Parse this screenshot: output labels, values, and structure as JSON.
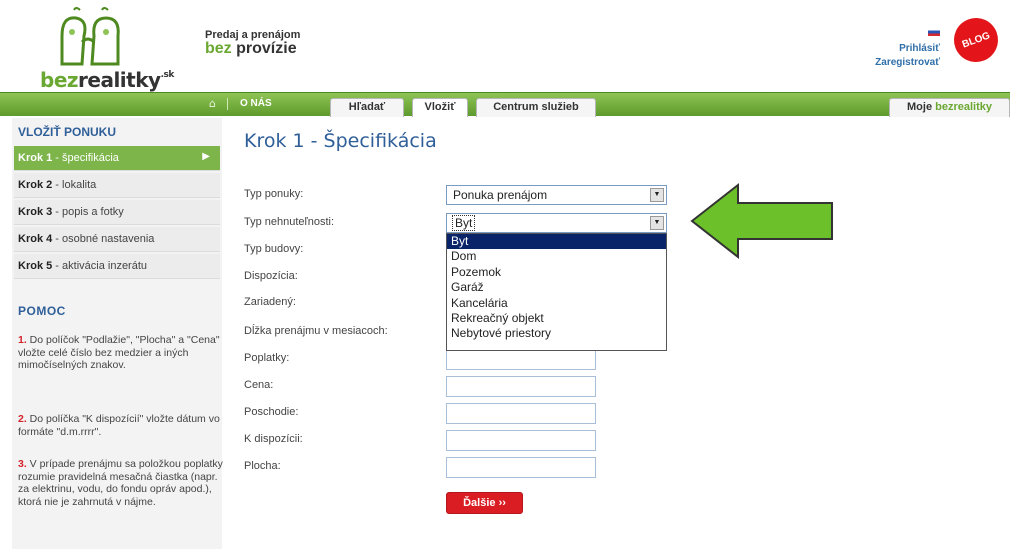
{
  "header": {
    "logo": {
      "brand_green": "bez",
      "brand_dark": "realitky",
      "brand_tld": ".sk"
    },
    "tagline": {
      "line1": "Predaj a prenájom",
      "line2_green": "bez",
      "line2_dark": "provízie"
    },
    "user_links": {
      "login": "Prihlásiť",
      "register": "Zaregistrovať"
    },
    "blog_badge": "BLOG"
  },
  "nav": {
    "home_icon": "⌂",
    "about": "O NÁS",
    "tabs": [
      {
        "label": "Hľadať"
      },
      {
        "label": "Vložiť"
      },
      {
        "label": "Centrum služieb"
      }
    ],
    "my_account": {
      "prefix": "Moje ",
      "green": "bezrealitky"
    }
  },
  "sidebar": {
    "title": "VLOŽIŤ PONUKU",
    "steps": [
      {
        "bold": "Krok 1",
        "rest": " - špecifikácia",
        "active": true
      },
      {
        "bold": "Krok 2",
        "rest": " - lokalita"
      },
      {
        "bold": "Krok 3",
        "rest": " - popis a fotky"
      },
      {
        "bold": "Krok 4",
        "rest": " - osobné nastavenia"
      },
      {
        "bold": "Krok 5",
        "rest": " - aktivácia inzerátu"
      }
    ],
    "help": {
      "title": "POMOC",
      "items": [
        {
          "num": "1.",
          "text": " Do políčok \"Podlažie\", \"Plocha\" a \"Cena\" vložte celé číslo bez medzier a iných mimočíselných znakov."
        },
        {
          "num": "2.",
          "text": " Do políčka \"K dispozícií\" vložte dátum vo formáte \"d.m.rrrr\"."
        },
        {
          "num": "3.",
          "text": " V prípade prenájmu sa položkou poplatky rozumie pravidelná mesačná čiastka (napr. za elektrinu, vodu, do fondu opráv apod.), ktorá nie je zahrnutá v nájme."
        }
      ]
    }
  },
  "main": {
    "title": "Krok 1 - Špecifikácia",
    "fields": {
      "offer_type": {
        "label": "Typ ponuky:",
        "value": "Ponuka prenájom"
      },
      "property_type": {
        "label": "Typ nehnuteľnosti:",
        "value": "Byt"
      },
      "building_type": {
        "label": "Typ budovy:"
      },
      "layout": {
        "label": "Dispozícia:"
      },
      "furnished": {
        "label": "Zariadený:"
      },
      "rent_length": {
        "label": "Dĺžka prenájmu v mesiacoch:"
      },
      "fees": {
        "label": "Poplatky:"
      },
      "price": {
        "label": "Cena:"
      },
      "floor": {
        "label": "Poschodie:"
      },
      "available": {
        "label": "K dispozícii:"
      },
      "area": {
        "label": "Plocha:"
      }
    },
    "property_type_options": [
      "Byt",
      "Dom",
      "Pozemok",
      "Garáž",
      "Kancelária",
      "Rekreačný objekt",
      "Nebytové priestory"
    ],
    "next_button": "Ďalšie",
    "next_icon": "››"
  },
  "colors": {
    "green": "#6aa832",
    "blue_title": "#2f5f99",
    "red": "#d91d22",
    "selected": "#0a246a"
  }
}
